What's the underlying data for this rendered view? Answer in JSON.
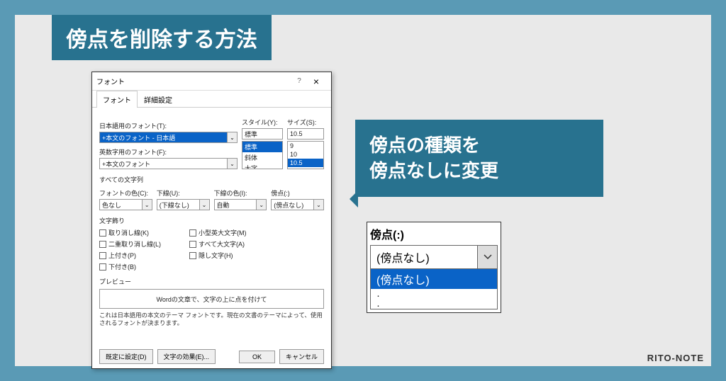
{
  "title": "傍点を削除する方法",
  "dialog": {
    "title": "フォント",
    "help": "?",
    "close": "×",
    "tabs": {
      "font": "フォント",
      "advanced": "詳細設定"
    },
    "jp_font_label": "日本語用のフォント(T):",
    "jp_font_value": "+本文のフォント - 日本語",
    "latin_font_label": "英数字用のフォント(F):",
    "latin_font_value": "+本文のフォント",
    "style_label": "スタイル(Y):",
    "style_value": "標準",
    "style_opts": [
      "標準",
      "斜体",
      "太字"
    ],
    "size_label": "サイズ(S):",
    "size_value": "10.5",
    "size_opts": [
      "9",
      "10",
      "10.5"
    ],
    "all_text": "すべての文字列",
    "font_color_label": "フォントの色(C):",
    "font_color_value": "色なし",
    "underline_label": "下線(U):",
    "underline_value": "(下線なし)",
    "underline_color_label": "下線の色(I):",
    "underline_color_value": "自動",
    "emphasis_label": "傍点(:)",
    "emphasis_value": "(傍点なし)",
    "decor": "文字飾り",
    "chk": {
      "strike": "取り消し線(K)",
      "dstrike": "二重取り消し線(L)",
      "sup": "上付き(P)",
      "sub": "下付き(B)",
      "smallcaps": "小型英大文字(M)",
      "allcaps": "すべて大文字(A)",
      "hidden": "隠し文字(H)"
    },
    "preview_label": "プレビュー",
    "preview_text": "Wordの文章で、文字の上に点を付けて",
    "desc": "これは日本語用の本文のテーマ フォントです。現在の文書のテーマによって、使用されるフォントが決まります。",
    "set_default": "既定に設定(D)",
    "text_effects": "文字の効果(E)...",
    "ok": "OK",
    "cancel": "キャンセル"
  },
  "callout": {
    "line1": "傍点の種類を",
    "line2": "傍点なしに変更"
  },
  "popup": {
    "label": "傍点(:)",
    "value": "(傍点なし)",
    "selected": "(傍点なし)",
    "dot1": "･",
    "dot2": "･"
  },
  "watermark": "RITO-NOTE"
}
